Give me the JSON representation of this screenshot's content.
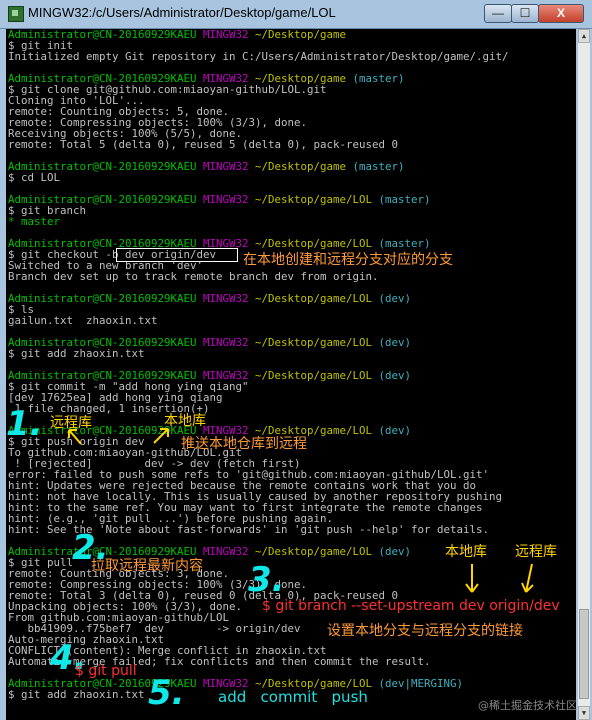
{
  "window": {
    "title": "MINGW32:/c/Users/Administrator/Desktop/game/LOL",
    "minimize": "—",
    "maximize": "☐",
    "close": "X"
  },
  "terminal": {
    "lines": [
      [
        {
          "t": "Administrator@CN-20160929KAEU ",
          "c": "u"
        },
        {
          "t": "MINGW32 ",
          "c": "m"
        },
        {
          "t": "~/Desktop/game",
          "c": "p"
        }
      ],
      [
        {
          "t": "$ git init"
        }
      ],
      [
        {
          "t": "Initialized empty Git repository in C:/Users/Administrator/Desktop/game/.git/"
        }
      ],
      [
        {
          "t": ""
        }
      ],
      [
        {
          "t": "Administrator@CN-20160929KAEU ",
          "c": "u"
        },
        {
          "t": "MINGW32 ",
          "c": "m"
        },
        {
          "t": "~/Desktop/game ",
          "c": "p"
        },
        {
          "t": "(master)",
          "c": "b"
        }
      ],
      [
        {
          "t": "$ git clone git@github.com:miaoyan-github/LOL.git"
        }
      ],
      [
        {
          "t": "Cloning into 'LOL'..."
        }
      ],
      [
        {
          "t": "remote: Counting objects: 5, done."
        }
      ],
      [
        {
          "t": "remote: Compressing objects: 100% (3/3), done."
        }
      ],
      [
        {
          "t": "Receiving objects: 100% (5/5), done."
        }
      ],
      [
        {
          "t": "remote: Total 5 (delta 0), reused 5 (delta 0), pack-reused 0"
        }
      ],
      [
        {
          "t": ""
        }
      ],
      [
        {
          "t": "Administrator@CN-20160929KAEU ",
          "c": "u"
        },
        {
          "t": "MINGW32 ",
          "c": "m"
        },
        {
          "t": "~/Desktop/game ",
          "c": "p"
        },
        {
          "t": "(master)",
          "c": "b"
        }
      ],
      [
        {
          "t": "$ cd LOL"
        }
      ],
      [
        {
          "t": ""
        }
      ],
      [
        {
          "t": "Administrator@CN-20160929KAEU ",
          "c": "u"
        },
        {
          "t": "MINGW32 ",
          "c": "m"
        },
        {
          "t": "~/Desktop/game/LOL ",
          "c": "p"
        },
        {
          "t": "(master)",
          "c": "b"
        }
      ],
      [
        {
          "t": "$ git branch"
        }
      ],
      [
        {
          "t": "* master",
          "c": "u"
        }
      ],
      [
        {
          "t": ""
        }
      ],
      [
        {
          "t": "Administrator@CN-20160929KAEU ",
          "c": "u"
        },
        {
          "t": "MINGW32 ",
          "c": "m"
        },
        {
          "t": "~/Desktop/game/LOL ",
          "c": "p"
        },
        {
          "t": "(master)",
          "c": "b"
        }
      ],
      [
        {
          "t": "$ git checkout -b dev origin/dev"
        }
      ],
      [
        {
          "t": "Switched to a new branch 'dev'"
        }
      ],
      [
        {
          "t": "Branch dev set up to track remote branch dev from origin."
        }
      ],
      [
        {
          "t": ""
        }
      ],
      [
        {
          "t": "Administrator@CN-20160929KAEU ",
          "c": "u"
        },
        {
          "t": "MINGW32 ",
          "c": "m"
        },
        {
          "t": "~/Desktop/game/LOL ",
          "c": "p"
        },
        {
          "t": "(dev)",
          "c": "b"
        }
      ],
      [
        {
          "t": "$ ls"
        }
      ],
      [
        {
          "t": "gailun.txt  zhaoxin.txt"
        }
      ],
      [
        {
          "t": ""
        }
      ],
      [
        {
          "t": "Administrator@CN-20160929KAEU ",
          "c": "u"
        },
        {
          "t": "MINGW32 ",
          "c": "m"
        },
        {
          "t": "~/Desktop/game/LOL ",
          "c": "p"
        },
        {
          "t": "(dev)",
          "c": "b"
        }
      ],
      [
        {
          "t": "$ git add zhaoxin.txt"
        }
      ],
      [
        {
          "t": ""
        }
      ],
      [
        {
          "t": "Administrator@CN-20160929KAEU ",
          "c": "u"
        },
        {
          "t": "MINGW32 ",
          "c": "m"
        },
        {
          "t": "~/Desktop/game/LOL ",
          "c": "p"
        },
        {
          "t": "(dev)",
          "c": "b"
        }
      ],
      [
        {
          "t": "$ git commit -m \"add hong ying qiang\""
        }
      ],
      [
        {
          "t": "[dev 17625ea] add hong ying qiang"
        }
      ],
      [
        {
          "t": " 1 file changed, 1 insertion(+)"
        }
      ],
      [
        {
          "t": ""
        }
      ],
      [
        {
          "t": "Administrator@CN-20160929KAEU ",
          "c": "u"
        },
        {
          "t": "MINGW32 ",
          "c": "m"
        },
        {
          "t": "~/Desktop/game/LOL ",
          "c": "p"
        },
        {
          "t": "(dev)",
          "c": "b"
        }
      ],
      [
        {
          "t": "$ git push origin dev"
        }
      ],
      [
        {
          "t": "To github.com:miaoyan-github/LOL.git"
        }
      ],
      [
        {
          "t": " ! [rejected]        dev -> dev (fetch first)",
          "c": "r"
        }
      ],
      [
        {
          "t": "error: failed to push some refs to 'git@github.com:miaoyan-github/LOL.git'"
        }
      ],
      [
        {
          "t": "hint: Updates were rejected because the remote contains work that you do"
        }
      ],
      [
        {
          "t": "hint: not have locally. This is usually caused by another repository pushing"
        }
      ],
      [
        {
          "t": "hint: to the same ref. You may want to first integrate the remote changes"
        }
      ],
      [
        {
          "t": "hint: (e.g., 'git pull ...') before pushing again."
        }
      ],
      [
        {
          "t": "hint: See the 'Note about fast-forwards' in 'git push --help' for details."
        }
      ],
      [
        {
          "t": ""
        }
      ],
      [
        {
          "t": "Administrator@CN-20160929KAEU ",
          "c": "u"
        },
        {
          "t": "MINGW32 ",
          "c": "m"
        },
        {
          "t": "~/Desktop/game/LOL ",
          "c": "p"
        },
        {
          "t": "(dev)",
          "c": "b"
        }
      ],
      [
        {
          "t": "$ git pull"
        }
      ],
      [
        {
          "t": "remote: Counting objects: 3, done."
        }
      ],
      [
        {
          "t": "remote: Compressing objects: 100% (3/3), done."
        }
      ],
      [
        {
          "t": "remote: Total 3 (delta 0), reused 0 (delta 0), pack-reused 0"
        }
      ],
      [
        {
          "t": "Unpacking objects: 100% (3/3), done."
        }
      ],
      [
        {
          "t": "From github.com:miaoyan-github/LOL"
        }
      ],
      [
        {
          "t": "   bb41909..f75bef7  dev        -> origin/dev"
        }
      ],
      [
        {
          "t": "Auto-merging zhaoxin.txt"
        }
      ],
      [
        {
          "t": "CONFLICT (content): Merge conflict in zhaoxin.txt"
        }
      ],
      [
        {
          "t": "Automatic merge failed; fix conflicts and then commit the result."
        }
      ],
      [
        {
          "t": ""
        }
      ],
      [
        {
          "t": "Administrator@CN-20160929KAEU ",
          "c": "u"
        },
        {
          "t": "MINGW32 ",
          "c": "m"
        },
        {
          "t": "~/Desktop/game/LOL ",
          "c": "p"
        },
        {
          "t": "(dev|MERGING)",
          "c": "b"
        }
      ],
      [
        {
          "t": "$ git add zhaoxin.txt"
        }
      ]
    ]
  },
  "annotations": {
    "checkout_note": "在本地创建和远程分支对应的分支",
    "step1_num": "1.",
    "remote_repo_1": "远程库",
    "local_repo_1": "本地库",
    "push_note": "推送本地仓库到远程",
    "step2_num": "2.",
    "pull_note": "拉取远程最新内容",
    "step3_num": "3.",
    "local_repo_2": "本地库",
    "remote_repo_2": "远程库",
    "set_upstream_cmd": "$ git branch --set-upstream dev origin/dev",
    "set_upstream_note": "设置本地分支与远程分支的链接",
    "step4_num": "4.",
    "git_pull_label": "$ git pull",
    "step5_num": "5.",
    "add_commit_push": "add   commit   push",
    "watermark": "@稀土掘金技术社区"
  }
}
